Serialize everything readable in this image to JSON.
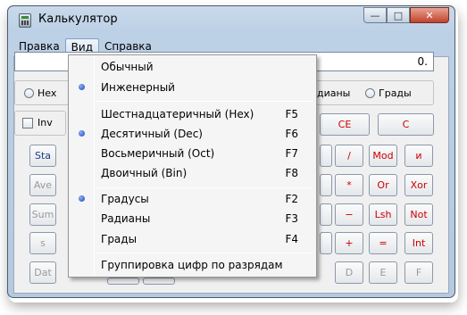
{
  "window": {
    "title": "Калькулятор",
    "controls": {
      "minimize": "—",
      "maximize": "□",
      "close": "✕"
    }
  },
  "menubar": {
    "items": [
      {
        "label": "Правка"
      },
      {
        "label": "Вид",
        "active": true
      },
      {
        "label": "Справка"
      }
    ]
  },
  "display": {
    "value": "0."
  },
  "number_system": {
    "hex": "Hex"
  },
  "angle_units": {
    "radians_partial": "дианы",
    "grads": "Грады"
  },
  "inv": {
    "label": "Inv"
  },
  "stat_buttons": [
    "Sta",
    "Ave",
    "Sum",
    "s",
    "Dat"
  ],
  "top_buttons": {
    "ce": "CE",
    "c": "C"
  },
  "op_buttons": [
    {
      "label": "/"
    },
    {
      "label": "Mod"
    },
    {
      "label": "и"
    },
    {
      "label": "*"
    },
    {
      "label": "Or"
    },
    {
      "label": "Xor"
    },
    {
      "label": "−"
    },
    {
      "label": "Lsh"
    },
    {
      "label": "Not"
    },
    {
      "label": "+"
    },
    {
      "label": "="
    },
    {
      "label": "Int"
    }
  ],
  "hex_digits": [
    "D",
    "E",
    "F"
  ],
  "view_menu": {
    "group1": [
      {
        "label": "Обычный",
        "checked": false
      },
      {
        "label": "Инженерный",
        "checked": true
      }
    ],
    "group2": [
      {
        "label": "Шестнадцатеричный (Hex)",
        "shortcut": "F5",
        "checked": false
      },
      {
        "label": "Десятичный (Dec)",
        "shortcut": "F6",
        "checked": true
      },
      {
        "label": "Восьмеричный (Oct)",
        "shortcut": "F7",
        "checked": false
      },
      {
        "label": "Двоичный (Bin)",
        "shortcut": "F8",
        "checked": false
      }
    ],
    "group3": [
      {
        "label": "Градусы",
        "shortcut": "F2",
        "checked": true
      },
      {
        "label": "Радианы",
        "shortcut": "F3",
        "checked": false
      },
      {
        "label": "Грады",
        "shortcut": "F4",
        "checked": false
      }
    ],
    "group4": [
      {
        "label": "Группировка цифр по разрядам"
      }
    ]
  }
}
